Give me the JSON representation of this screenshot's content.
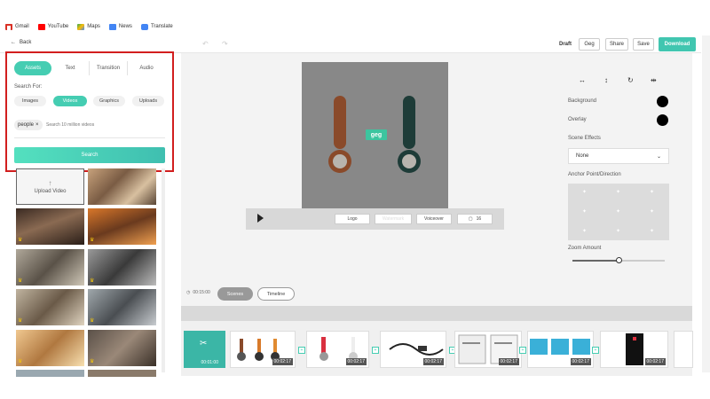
{
  "bookmarks": [
    {
      "label": "Gmail",
      "icon": "gmail-icon",
      "color": "#d93025"
    },
    {
      "label": "YouTube",
      "icon": "youtube-icon",
      "color": "#ff0000"
    },
    {
      "label": "Maps",
      "icon": "maps-icon",
      "color": "#34a853"
    },
    {
      "label": "News",
      "icon": "news-icon",
      "color": "#4285f4"
    },
    {
      "label": "Translate",
      "icon": "translate-icon",
      "color": "#4285f4"
    }
  ],
  "toolbar": {
    "back_label": "Back",
    "draft_label": "Draft",
    "project_name": "Geg",
    "share_label": "Share",
    "save_label": "Save",
    "download_label": "Download"
  },
  "left_panel": {
    "tabs": [
      {
        "label": "Assets",
        "active": true
      },
      {
        "label": "Text",
        "active": false
      },
      {
        "label": "Transition",
        "active": false
      },
      {
        "label": "Audio",
        "active": false
      }
    ],
    "search_for_label": "Search For:",
    "filters": [
      {
        "label": "Images",
        "active": false
      },
      {
        "label": "Videos",
        "active": true
      },
      {
        "label": "Graphics",
        "active": false
      },
      {
        "label": "Uploads",
        "active": false
      }
    ],
    "tag": "people",
    "search_placeholder": "Search 10 million videos",
    "search_button": "Search",
    "upload_label": "Upload Video"
  },
  "canvas": {
    "overlay_text": "geg",
    "controls": {
      "logo_label": "Logo",
      "watermark_label": "Watermark",
      "voiceover_label": "Voiceover",
      "aspect_label": "16"
    }
  },
  "view": {
    "time": "00:15:00",
    "scenes_label": "Scenes",
    "timeline_label": "Timeline"
  },
  "right_panel": {
    "background_label": "Background",
    "overlay_label": "Overlay",
    "scene_effects_label": "Scene Effects",
    "scene_effect_value": "None",
    "anchor_label": "Anchor Point/Direction",
    "zoom_label": "Zoom Amount",
    "zoom_value": 0.5,
    "background_color": "#000000",
    "overlay_color": "#000000"
  },
  "scenes": [
    {
      "time": "00:01:00"
    },
    {
      "time": "00:02:17"
    },
    {
      "time": "00:02:17"
    },
    {
      "time": "00:02:17"
    },
    {
      "time": "00:02:17"
    },
    {
      "time": "00:02:17"
    },
    {
      "time": "00:02:17"
    }
  ],
  "colors": {
    "accent": "#45cdb2",
    "highlight_border": "#d21e1e"
  }
}
